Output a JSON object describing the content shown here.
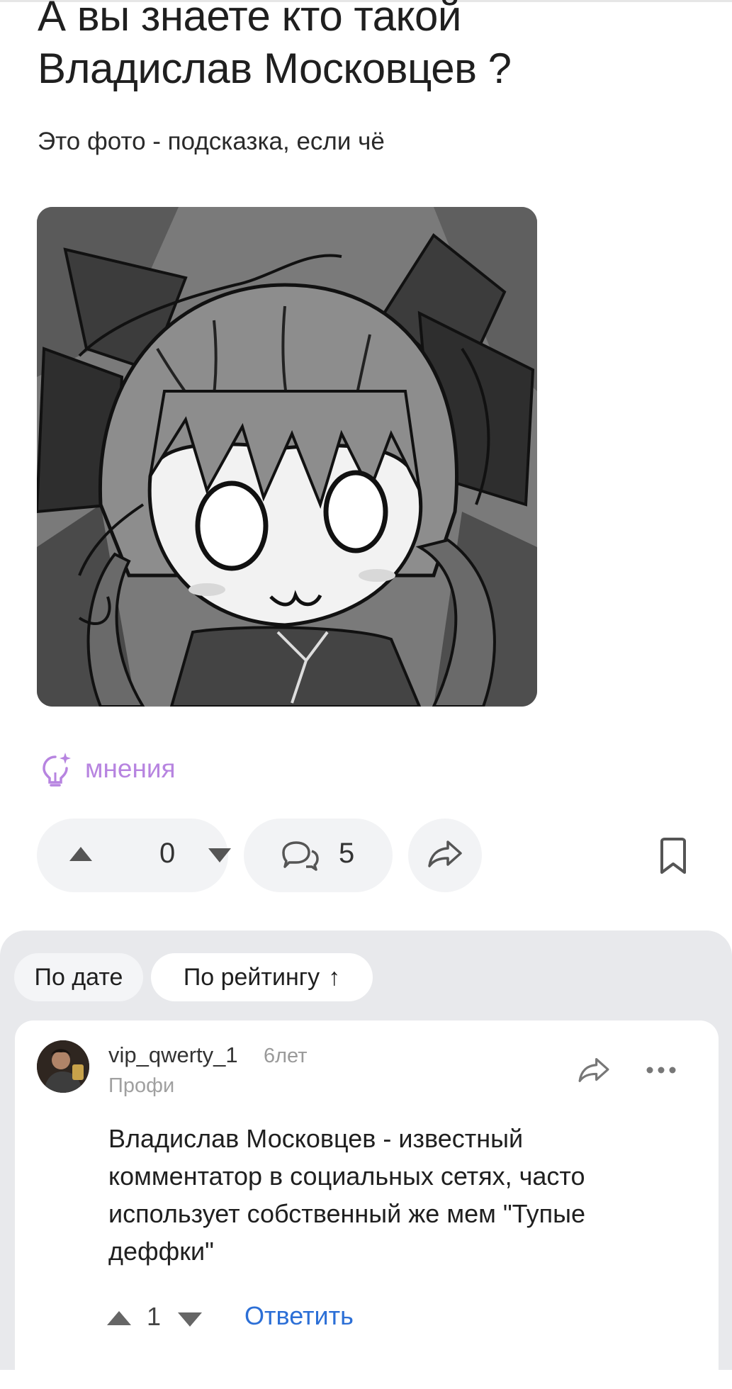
{
  "post": {
    "title": "А вы знаете кто такой Владислав Московцев ?",
    "subtitle": "Это фото - подсказка, если чё",
    "image_icon": "anime-catgirl-drawing"
  },
  "tag": {
    "icon": "lightbulb-sparkle-icon",
    "label": "мнения",
    "color": "#b784e0"
  },
  "actions": {
    "vote_count": "0",
    "comment_count": "5",
    "share_icon": "share-arrow-icon",
    "bookmark_icon": "bookmark-icon"
  },
  "sorting": {
    "by_date": "По дате",
    "by_rating": "По рейтингу",
    "by_rating_arrow": "↑"
  },
  "comment": {
    "username": "vip_qwerty_1",
    "time": "6лет",
    "rank": "Профи",
    "text": "Владислав Московцев - известный комментатор в социальных сетях, часто использует собственный же мем \"Тупые деффки\"",
    "rating": "1",
    "reply_label": "Ответить",
    "reply_color": "#2c6fd6"
  }
}
